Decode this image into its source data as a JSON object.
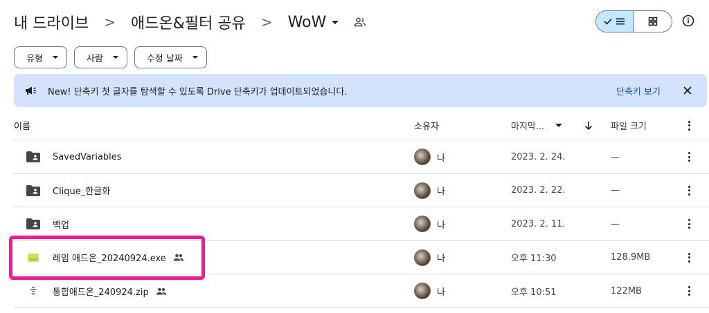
{
  "breadcrumb": {
    "items": [
      "내 드라이브",
      "애드온&필터 공유",
      "WoW"
    ],
    "separator": ">"
  },
  "filters": {
    "type_label": "유형",
    "people_label": "사람",
    "modified_label": "수정 날짜"
  },
  "banner": {
    "text": "New! 단축키 첫 글자를 탐색할 수 있도록 Drive 단축키가 업데이트되었습니다.",
    "link": "단축키 보기"
  },
  "table": {
    "headers": {
      "name": "이름",
      "owner": "소유자",
      "modified": "마지막...",
      "size": "파일 크기"
    },
    "rows": [
      {
        "name": "SavedVariables",
        "kind": "shared-folder-icon",
        "shared": false,
        "owner": "나",
        "modified": "2023. 2. 24.",
        "size": "—"
      },
      {
        "name": "Clique_한글화",
        "kind": "shared-folder-icon",
        "shared": false,
        "owner": "나",
        "modified": "2023. 2. 22.",
        "size": "—"
      },
      {
        "name": "백업",
        "kind": "shared-folder-icon",
        "shared": false,
        "owner": "나",
        "modified": "2023. 2. 11.",
        "size": "—"
      },
      {
        "name": "레임 애드온_20240924.exe",
        "kind": "exe-file-icon",
        "shared": true,
        "owner": "나",
        "modified": "오후 11:30",
        "size": "128.9MB"
      },
      {
        "name": "통합애드온_240924.zip",
        "kind": "zip-file-icon",
        "shared": true,
        "owner": "나",
        "modified": "오후 10:51",
        "size": "122MB"
      }
    ]
  },
  "colors": {
    "accent": "#0b57d0",
    "banner_bg": "#d3e3fd",
    "toggle_active": "#c2e7ff",
    "highlight": "#ff1493",
    "exe_icon": "#c8e05a"
  }
}
